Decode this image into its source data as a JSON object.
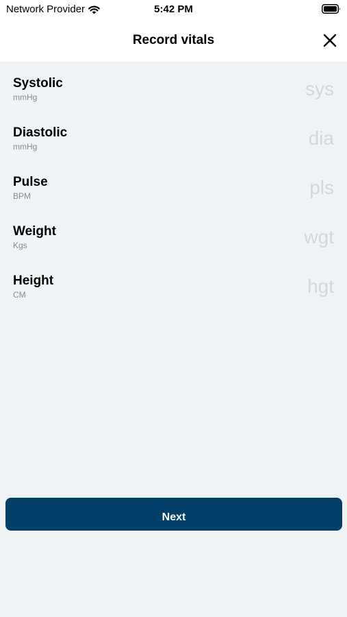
{
  "status_bar": {
    "carrier": "Network Provider",
    "time": "5:42 PM",
    "wifi_icon": "wifi-icon",
    "battery_icon": "battery-icon"
  },
  "nav": {
    "title": "Record vitals",
    "close_icon": "close-icon"
  },
  "fields": [
    {
      "label": "Systolic",
      "unit": "mmHg",
      "placeholder": "sys",
      "value": ""
    },
    {
      "label": "Diastolic",
      "unit": "mmHg",
      "placeholder": "dia",
      "value": ""
    },
    {
      "label": "Pulse",
      "unit": "BPM",
      "placeholder": "pls",
      "value": ""
    },
    {
      "label": "Weight",
      "unit": "Kgs",
      "placeholder": "wgt",
      "value": ""
    },
    {
      "label": "Height",
      "unit": "CM",
      "placeholder": "hgt",
      "value": ""
    }
  ],
  "next_button": {
    "label": "Next",
    "color": "#02406a"
  },
  "colors": {
    "background": "#eff3f6",
    "header": "#ffffff",
    "placeholder": "#d3d6d9",
    "unit_text": "#8a8a8e"
  }
}
